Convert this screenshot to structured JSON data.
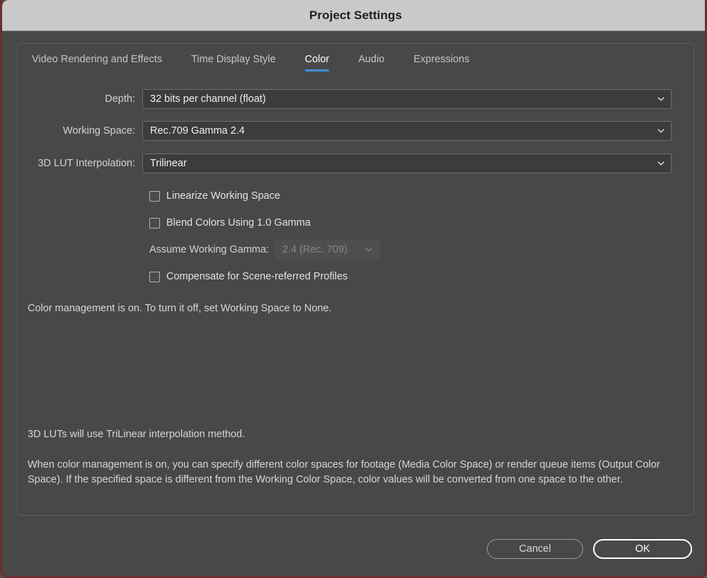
{
  "window": {
    "title": "Project Settings",
    "border_color": "#6b2e2e",
    "titlebar_bg": "#c9c9c9",
    "body_bg": "#484848"
  },
  "tabs": {
    "accent_color": "#3f8fd4",
    "items": [
      {
        "label": "Video Rendering and Effects",
        "active": false
      },
      {
        "label": "Time Display Style",
        "active": false
      },
      {
        "label": "Color",
        "active": true
      },
      {
        "label": "Audio",
        "active": false
      },
      {
        "label": "Expressions",
        "active": false
      }
    ]
  },
  "fields": [
    {
      "label": "Depth:",
      "value": "32 bits per channel (float)"
    },
    {
      "label": "Working Space:",
      "value": "Rec.709 Gamma 2.4"
    },
    {
      "label": "3D LUT Interpolation:",
      "value": "Trilinear"
    }
  ],
  "checkboxes": [
    {
      "label": "Linearize Working Space",
      "checked": false
    },
    {
      "label": "Blend Colors Using 1.0 Gamma",
      "checked": false
    },
    {
      "label": "Compensate for Scene-referred Profiles",
      "checked": false
    }
  ],
  "gamma_field": {
    "label": "Assume Working Gamma:",
    "value": "2.4 (Rec. 709)",
    "disabled": true
  },
  "status": {
    "message": "Color management is on. To turn it off, set Working Space to None."
  },
  "descriptions": {
    "lut_note": "3D LUTs will use TriLinear interpolation method.",
    "color_management_note": "When color management is on, you can specify different color spaces for footage (Media Color Space) or render queue items (Output Color Space). If the specified space is different from the Working Color Space, color values will be converted from one space to the other."
  },
  "footer": {
    "cancel_label": "Cancel",
    "ok_label": "OK"
  }
}
